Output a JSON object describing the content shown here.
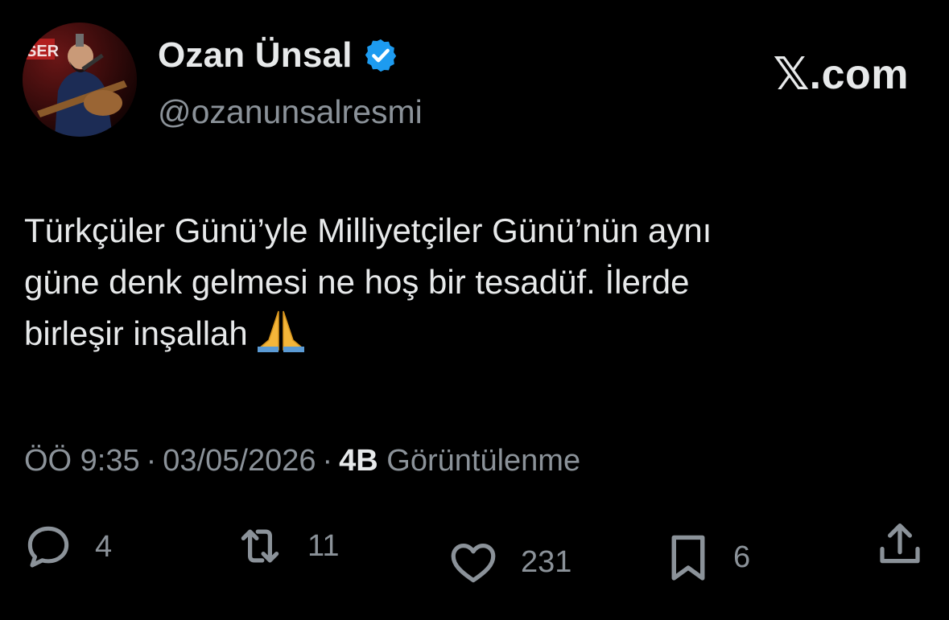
{
  "author": {
    "name": "Ozan Ünsal",
    "handle": "@ozanunsalresmi",
    "verified": true,
    "avatar_sign_text": "SER"
  },
  "brand": {
    "x_glyph": "𝕏",
    "text": ".com"
  },
  "tweet": {
    "lines": [
      "Türkçüler Günü’yle Milliyetçiler Günü’nün aynı",
      "güne denk gelmesi ne hoş bir tesadüf. İlerde",
      "birleşir inşallah"
    ],
    "emoji": "folded-hands"
  },
  "meta": {
    "time": "ÖÖ 9:35",
    "separator": "·",
    "date": "03/05/2026",
    "views_count": "4B",
    "views_label": "Görüntülenme"
  },
  "actions": {
    "replies": "4",
    "reposts": "11",
    "likes": "231",
    "bookmarks": "6"
  },
  "colors": {
    "background": "#000000",
    "text": "#e7e9ea",
    "secondary": "#8b9299",
    "verified": "#1d9bf0"
  }
}
